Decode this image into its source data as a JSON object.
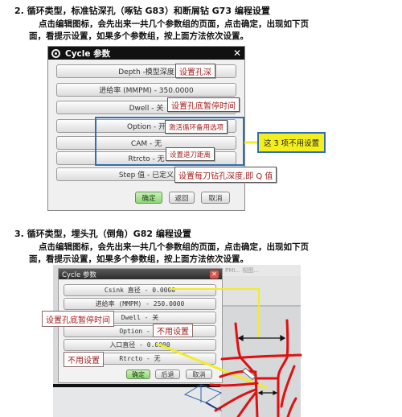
{
  "section2": {
    "heading": "2. 循环类型，标准钻深孔（啄钻 G83）和断屑钻 G73 编程设置",
    "line1": "点击编辑图标，会先出来一共几个参数组的页面，点击确定，出现如下页",
    "line2": "面，看提示设置，如果多个参数组，按上面方法依次设置。",
    "dialog": {
      "title": "Cycle 参数",
      "close_icon": "close-icon",
      "params": [
        {
          "label": "Depth -模型深度"
        },
        {
          "label": "进给率 (MMPM) - 350.0000"
        },
        {
          "label": "Dwell - 关"
        },
        {
          "label": "Option - 开"
        },
        {
          "label": "CAM - 无"
        },
        {
          "label": "Rtrcto - 无"
        },
        {
          "label": "Step 值 - 已定义"
        }
      ],
      "buttons": {
        "ok": "确定",
        "back": "返回",
        "cancel": "取消"
      }
    },
    "annotations": {
      "depth": "设置孔深",
      "dwell": "设置孔底暂停时间",
      "option": "激活循环备用选项",
      "rtrcto": "设置退刀距离",
      "step": "设置每刀钻孔深度,即 Q 值",
      "group_note": "这 3 项不用设置"
    }
  },
  "section3": {
    "heading": "3. 循环类型，埋头孔（倒角）G82 编程设置",
    "line1": "点击编辑图标，会先出来一共几个参数组的页面，点击确定，出现如下页",
    "line2": "面，看提示设置，如果多个参数组，按上面方法依次设置。",
    "dialog": {
      "title": "Cycle 参数",
      "params": [
        {
          "label": "Csink 直径 - 0.0000"
        },
        {
          "label": "进给率 (MMPM) - 250.0000"
        },
        {
          "label": "Dwell - 关"
        },
        {
          "label": "Option - 关"
        },
        {
          "label": "入口直径 - 0.0000"
        },
        {
          "label": "Rtrcto - 无"
        }
      ],
      "buttons": {
        "ok": "确定",
        "back": "后退",
        "cancel": "取消"
      }
    },
    "annotations": {
      "dwell": "设置孔底暂停时间",
      "option": "不用设置",
      "rtrcto": "不用设置"
    },
    "background_tabs": "PMI... 视图..."
  },
  "colors": {
    "annotation_text": "#a61c1c",
    "highlight_box": "#2e6fb5",
    "yellow_note": "#f4ee1e",
    "ok_button": "#8fd678",
    "drawing_lines": "#e01010"
  }
}
